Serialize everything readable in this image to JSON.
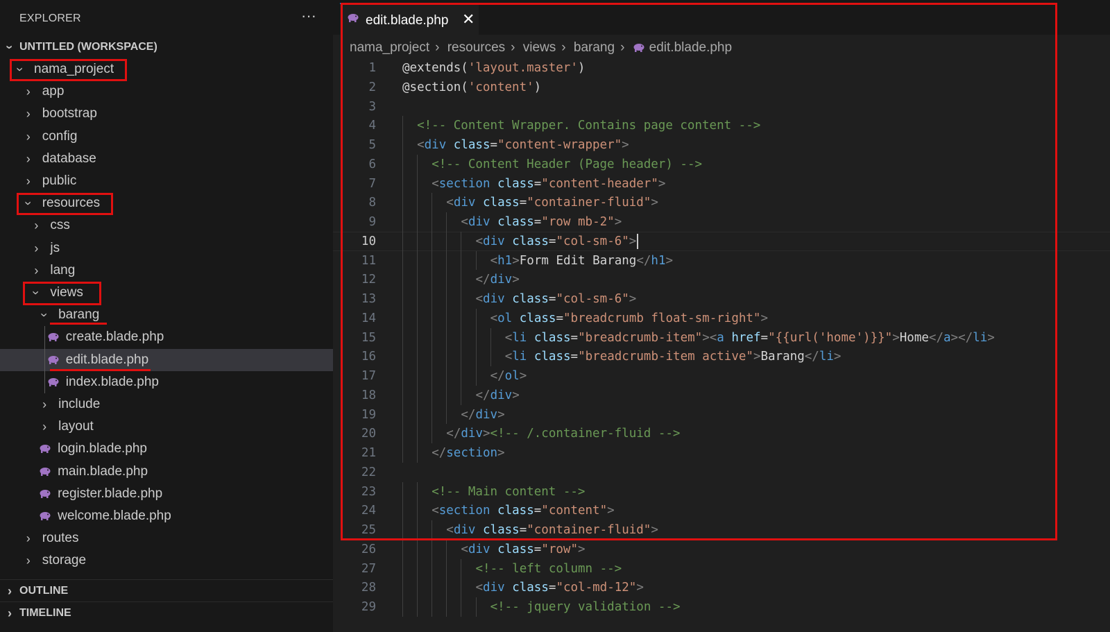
{
  "sidebar": {
    "title": "EXPLORER",
    "more_label": "···",
    "workspace_label": "UNTITLED (WORKSPACE)",
    "tree": [
      {
        "label": "nama_project",
        "kind": "folder",
        "open": true,
        "depth": 1
      },
      {
        "label": "app",
        "kind": "folder",
        "open": false,
        "depth": 2
      },
      {
        "label": "bootstrap",
        "kind": "folder",
        "open": false,
        "depth": 2
      },
      {
        "label": "config",
        "kind": "folder",
        "open": false,
        "depth": 2
      },
      {
        "label": "database",
        "kind": "folder",
        "open": false,
        "depth": 2
      },
      {
        "label": "public",
        "kind": "folder",
        "open": false,
        "depth": 2
      },
      {
        "label": "resources",
        "kind": "folder",
        "open": true,
        "depth": 2
      },
      {
        "label": "css",
        "kind": "folder",
        "open": false,
        "depth": 3
      },
      {
        "label": "js",
        "kind": "folder",
        "open": false,
        "depth": 3
      },
      {
        "label": "lang",
        "kind": "folder",
        "open": false,
        "depth": 3
      },
      {
        "label": "views",
        "kind": "folder",
        "open": true,
        "depth": 3
      },
      {
        "label": "barang",
        "kind": "folder",
        "open": true,
        "depth": 4
      },
      {
        "label": "create.blade.php",
        "kind": "file",
        "depth": 5
      },
      {
        "label": "edit.blade.php",
        "kind": "file",
        "depth": 5,
        "selected": true
      },
      {
        "label": "index.blade.php",
        "kind": "file",
        "depth": 5
      },
      {
        "label": "include",
        "kind": "folder",
        "open": false,
        "depth": 4
      },
      {
        "label": "layout",
        "kind": "folder",
        "open": false,
        "depth": 4
      },
      {
        "label": "login.blade.php",
        "kind": "file",
        "depth": 4
      },
      {
        "label": "main.blade.php",
        "kind": "file",
        "depth": 4
      },
      {
        "label": "register.blade.php",
        "kind": "file",
        "depth": 4
      },
      {
        "label": "welcome.blade.php",
        "kind": "file",
        "depth": 4
      },
      {
        "label": "routes",
        "kind": "folder",
        "open": false,
        "depth": 2
      },
      {
        "label": "storage",
        "kind": "folder",
        "open": false,
        "depth": 2
      }
    ],
    "outline_label": "OUTLINE",
    "timeline_label": "TIMELINE"
  },
  "editor": {
    "tab_label": "edit.blade.php",
    "tab_close": "✕",
    "breadcrumb": [
      "nama_project",
      "resources",
      "views",
      "barang",
      "edit.blade.php"
    ],
    "active_line": 10,
    "lines": [
      {
        "n": "1",
        "indent": 0,
        "tokens": [
          [
            "p",
            "@extends("
          ],
          [
            "s",
            "'layout.master'"
          ],
          [
            "p",
            ")"
          ]
        ]
      },
      {
        "n": "2",
        "indent": 0,
        "tokens": [
          [
            "p",
            "@section("
          ],
          [
            "s",
            "'content'"
          ],
          [
            "p",
            ")"
          ]
        ]
      },
      {
        "n": "3",
        "indent": 0,
        "tokens": []
      },
      {
        "n": "4",
        "indent": 1,
        "tokens": [
          [
            "c",
            "<!-- Content Wrapper. Contains page content -->"
          ]
        ]
      },
      {
        "n": "5",
        "indent": 1,
        "tokens": [
          [
            "b",
            "<"
          ],
          [
            "t",
            "div"
          ],
          [
            "p",
            " "
          ],
          [
            "a",
            "class"
          ],
          [
            "p",
            "="
          ],
          [
            "s",
            "\"content-wrapper\""
          ],
          [
            "b",
            ">"
          ]
        ]
      },
      {
        "n": "6",
        "indent": 2,
        "tokens": [
          [
            "c",
            "<!-- Content Header (Page header) -->"
          ]
        ]
      },
      {
        "n": "7",
        "indent": 2,
        "tokens": [
          [
            "b",
            "<"
          ],
          [
            "t",
            "section"
          ],
          [
            "p",
            " "
          ],
          [
            "a",
            "class"
          ],
          [
            "p",
            "="
          ],
          [
            "s",
            "\"content-header\""
          ],
          [
            "b",
            ">"
          ]
        ]
      },
      {
        "n": "8",
        "indent": 3,
        "tokens": [
          [
            "b",
            "<"
          ],
          [
            "t",
            "div"
          ],
          [
            "p",
            " "
          ],
          [
            "a",
            "class"
          ],
          [
            "p",
            "="
          ],
          [
            "s",
            "\"container-fluid\""
          ],
          [
            "b",
            ">"
          ]
        ]
      },
      {
        "n": "9",
        "indent": 4,
        "tokens": [
          [
            "b",
            "<"
          ],
          [
            "t",
            "div"
          ],
          [
            "p",
            " "
          ],
          [
            "a",
            "class"
          ],
          [
            "p",
            "="
          ],
          [
            "s",
            "\"row mb-2\""
          ],
          [
            "b",
            ">"
          ]
        ]
      },
      {
        "n": "10",
        "indent": 5,
        "tokens": [
          [
            "b",
            "<"
          ],
          [
            "t",
            "div"
          ],
          [
            "p",
            " "
          ],
          [
            "a",
            "class"
          ],
          [
            "p",
            "="
          ],
          [
            "s",
            "\"col-sm-6\""
          ],
          [
            "b",
            ">"
          ]
        ]
      },
      {
        "n": "11",
        "indent": 6,
        "tokens": [
          [
            "b",
            "<"
          ],
          [
            "t",
            "h1"
          ],
          [
            "b",
            ">"
          ],
          [
            "p",
            "Form Edit Barang"
          ],
          [
            "b",
            "</"
          ],
          [
            "t",
            "h1"
          ],
          [
            "b",
            ">"
          ]
        ]
      },
      {
        "n": "12",
        "indent": 5,
        "tokens": [
          [
            "b",
            "</"
          ],
          [
            "t",
            "div"
          ],
          [
            "b",
            ">"
          ]
        ]
      },
      {
        "n": "13",
        "indent": 5,
        "tokens": [
          [
            "b",
            "<"
          ],
          [
            "t",
            "div"
          ],
          [
            "p",
            " "
          ],
          [
            "a",
            "class"
          ],
          [
            "p",
            "="
          ],
          [
            "s",
            "\"col-sm-6\""
          ],
          [
            "b",
            ">"
          ]
        ]
      },
      {
        "n": "14",
        "indent": 6,
        "tokens": [
          [
            "b",
            "<"
          ],
          [
            "t",
            "ol"
          ],
          [
            "p",
            " "
          ],
          [
            "a",
            "class"
          ],
          [
            "p",
            "="
          ],
          [
            "s",
            "\"breadcrumb float-sm-right\""
          ],
          [
            "b",
            ">"
          ]
        ]
      },
      {
        "n": "15",
        "indent": 7,
        "tokens": [
          [
            "b",
            "<"
          ],
          [
            "t",
            "li"
          ],
          [
            "p",
            " "
          ],
          [
            "a",
            "class"
          ],
          [
            "p",
            "="
          ],
          [
            "s",
            "\"breadcrumb-item\""
          ],
          [
            "b",
            "><"
          ],
          [
            "t",
            "a"
          ],
          [
            "p",
            " "
          ],
          [
            "a",
            "href"
          ],
          [
            "p",
            "="
          ],
          [
            "s",
            "\"{{url('home')}}\""
          ],
          [
            "b",
            ">"
          ],
          [
            "p",
            "Home"
          ],
          [
            "b",
            "</"
          ],
          [
            "t",
            "a"
          ],
          [
            "b",
            "></"
          ],
          [
            "t",
            "li"
          ],
          [
            "b",
            ">"
          ]
        ]
      },
      {
        "n": "16",
        "indent": 7,
        "tokens": [
          [
            "b",
            "<"
          ],
          [
            "t",
            "li"
          ],
          [
            "p",
            " "
          ],
          [
            "a",
            "class"
          ],
          [
            "p",
            "="
          ],
          [
            "s",
            "\"breadcrumb-item active\""
          ],
          [
            "b",
            ">"
          ],
          [
            "p",
            "Barang"
          ],
          [
            "b",
            "</"
          ],
          [
            "t",
            "li"
          ],
          [
            "b",
            ">"
          ]
        ]
      },
      {
        "n": "17",
        "indent": 6,
        "tokens": [
          [
            "b",
            "</"
          ],
          [
            "t",
            "ol"
          ],
          [
            "b",
            ">"
          ]
        ]
      },
      {
        "n": "18",
        "indent": 5,
        "tokens": [
          [
            "b",
            "</"
          ],
          [
            "t",
            "div"
          ],
          [
            "b",
            ">"
          ]
        ]
      },
      {
        "n": "19",
        "indent": 4,
        "tokens": [
          [
            "b",
            "</"
          ],
          [
            "t",
            "div"
          ],
          [
            "b",
            ">"
          ]
        ]
      },
      {
        "n": "20",
        "indent": 3,
        "tokens": [
          [
            "b",
            "</"
          ],
          [
            "t",
            "div"
          ],
          [
            "b",
            ">"
          ],
          [
            "c",
            "<!-- /.container-fluid -->"
          ]
        ]
      },
      {
        "n": "21",
        "indent": 2,
        "tokens": [
          [
            "b",
            "</"
          ],
          [
            "t",
            "section"
          ],
          [
            "b",
            ">"
          ]
        ]
      },
      {
        "n": "22",
        "indent": 0,
        "tokens": []
      },
      {
        "n": "23",
        "indent": 2,
        "tokens": [
          [
            "c",
            "<!-- Main content -->"
          ]
        ]
      },
      {
        "n": "24",
        "indent": 2,
        "tokens": [
          [
            "b",
            "<"
          ],
          [
            "t",
            "section"
          ],
          [
            "p",
            " "
          ],
          [
            "a",
            "class"
          ],
          [
            "p",
            "="
          ],
          [
            "s",
            "\"content\""
          ],
          [
            "b",
            ">"
          ]
        ]
      },
      {
        "n": "25",
        "indent": 3,
        "tokens": [
          [
            "b",
            "<"
          ],
          [
            "t",
            "div"
          ],
          [
            "p",
            " "
          ],
          [
            "a",
            "class"
          ],
          [
            "p",
            "="
          ],
          [
            "s",
            "\"container-fluid\""
          ],
          [
            "b",
            ">"
          ]
        ]
      },
      {
        "n": "26",
        "indent": 4,
        "tokens": [
          [
            "b",
            "<"
          ],
          [
            "t",
            "div"
          ],
          [
            "p",
            " "
          ],
          [
            "a",
            "class"
          ],
          [
            "p",
            "="
          ],
          [
            "s",
            "\"row\""
          ],
          [
            "b",
            ">"
          ]
        ]
      },
      {
        "n": "27",
        "indent": 5,
        "tokens": [
          [
            "c",
            "<!-- left column -->"
          ]
        ]
      },
      {
        "n": "28",
        "indent": 5,
        "tokens": [
          [
            "b",
            "<"
          ],
          [
            "t",
            "div"
          ],
          [
            "p",
            " "
          ],
          [
            "a",
            "class"
          ],
          [
            "p",
            "="
          ],
          [
            "s",
            "\"col-md-12\""
          ],
          [
            "b",
            ">"
          ]
        ]
      },
      {
        "n": "29",
        "indent": 6,
        "tokens": [
          [
            "c",
            "<!-- jquery validation -->"
          ]
        ]
      }
    ]
  },
  "colors": {
    "annotation_red": "#e01010",
    "php_icon": "#a074c4",
    "string": "#ce9178",
    "comment": "#6a9955",
    "tag": "#569cd6",
    "attribute": "#9cdcfe"
  }
}
